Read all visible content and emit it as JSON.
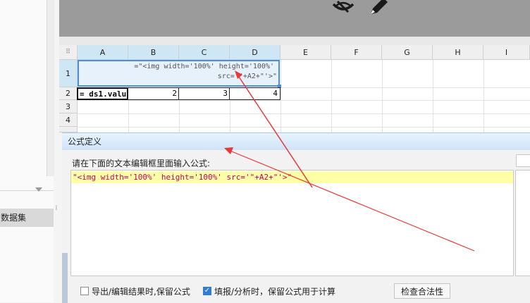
{
  "left_panel": {
    "dataset_tab": "数据集"
  },
  "sheet": {
    "columns": [
      "A",
      "B",
      "C",
      "D",
      "E",
      "F",
      "G",
      "H",
      "I"
    ],
    "rows": [
      "1",
      "2",
      "3",
      "4"
    ],
    "merged_cell": {
      "line1": "=\"<img width='100%'  height='100%'",
      "line2": "src='\"+A2+\"'>\""
    },
    "row2": {
      "a": "= ds1.valu",
      "b": "2",
      "c": "3",
      "d": "4"
    }
  },
  "dialog": {
    "title": "公式定义",
    "prompt": "请在下面的文本编辑框里面输入公式:",
    "formula": "\"<img width='100%' height='100%' src='\"+A2+\"'>\"",
    "export_keep_label": "导出/编辑结果时,保留公式",
    "fill_keep_label": "填报/分析时，保留公式用于计算",
    "check_button": "检查合法性"
  },
  "colors": {
    "annotation_arrow": "#e8393a",
    "selection": "#4a90d9"
  },
  "icons": [
    "eye-hidden-icon",
    "pencil-icon",
    "checkmark-icon"
  ]
}
